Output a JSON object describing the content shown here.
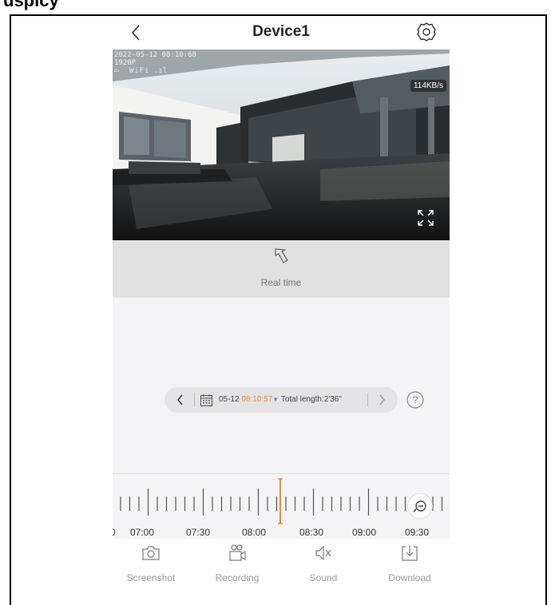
{
  "header": {
    "clipped_text": "uspicy"
  },
  "nav": {
    "title": "Device1",
    "back_icon": "chevron-left-icon",
    "settings_icon": "gear-icon"
  },
  "video": {
    "osd_timestamp": "2022-05-12 08:10:68",
    "osd_resolution": "1920P",
    "osd_signal": "WiFi",
    "speed": "114KB/s",
    "fullscreen_icon": "expand-icon"
  },
  "realtime": {
    "label": "Real time",
    "icon": "return-arrow-icon"
  },
  "playback": {
    "date": "05-12",
    "time": "08:10:57",
    "caret": "▼",
    "total": "Total length:2'36\"",
    "help": "?",
    "prev_icon": "chevron-left-icon",
    "next_icon": "chevron-right-icon",
    "calendar_icon": "calendar-icon",
    "colors": {
      "accent_orange": "#f08a2a",
      "accent_blue": "#3a8ee6"
    }
  },
  "timeline": {
    "labels": [
      "0",
      "07:00",
      "07:30",
      "08:00",
      "08:30",
      "09:00",
      "09:30"
    ],
    "cursor_time": "08:10:57",
    "zoom_icon": "zoom-out-icon",
    "cursor_color": "#f08a2a"
  },
  "toolbar": {
    "items": [
      {
        "label": "Screenshot",
        "icon": "camera-icon"
      },
      {
        "label": "Recording",
        "icon": "video-camera-icon"
      },
      {
        "label": "Sound",
        "icon": "speaker-muted-icon"
      },
      {
        "label": "Download",
        "icon": "download-icon"
      }
    ]
  }
}
